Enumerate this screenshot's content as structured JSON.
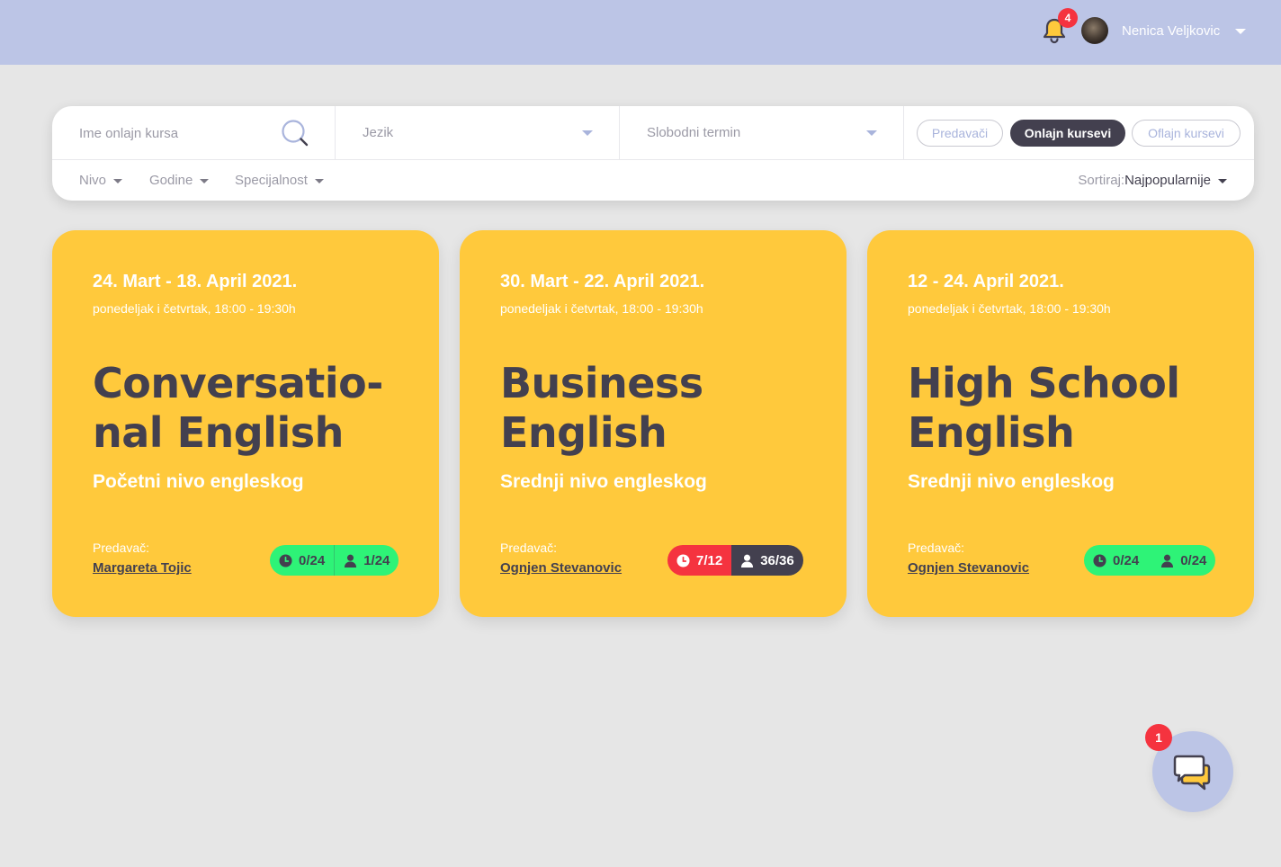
{
  "header": {
    "notifications_count": "4",
    "user_name": "Nenica Veljkovic"
  },
  "filters": {
    "search_placeholder": "Ime onlajn kursa",
    "language_placeholder": "Jezik",
    "slot_placeholder": "Slobodni termin",
    "tabs": [
      {
        "label": "Predavači",
        "active": false
      },
      {
        "label": "Onlajn kursevi",
        "active": true
      },
      {
        "label": "Oflajn kursevi",
        "active": false
      }
    ],
    "dropdowns": [
      "Nivo",
      "Godine",
      "Specijalnost"
    ],
    "sort_label": "Sortiraj:",
    "sort_value": "Najpopularnije"
  },
  "courses": [
    {
      "date": "24. Mart - 18. April 2021.",
      "schedule": "ponedeljak i četvrtak, 18:00 - 19:30h",
      "title_line1": "Conversatio-",
      "title_line2": "nal English",
      "level": "Početni nivo engleskog",
      "lecturer_label": "Predavač:",
      "lecturer": "Margareta Tojic",
      "hours": "0/24",
      "students": "1/24"
    },
    {
      "date": "30. Mart - 22. April 2021.",
      "schedule": "ponedeljak i četvrtak, 18:00 - 19:30h",
      "title_line1": "Business",
      "title_line2": "English",
      "level": "Srednji nivo engleskog",
      "lecturer_label": "Predavač:",
      "lecturer": "Ognjen Stevanovic",
      "hours": "7/12",
      "students": "36/36"
    },
    {
      "date": "12 - 24. April 2021.",
      "schedule": "ponedeljak i četvrtak, 18:00 - 19:30h",
      "title_line1": "High School",
      "title_line2": "English",
      "level": "Srednji nivo engleskog",
      "lecturer_label": "Predavač:",
      "lecturer": "Ognjen Stevanovic",
      "hours": "0/24",
      "students": "0/24"
    }
  ],
  "chat": {
    "unread_count": "1"
  },
  "colors": {
    "topbar": "#bcc5e6",
    "card": "#ffc93c",
    "dark": "#43404f",
    "green": "#2ef377",
    "red": "#f5333f"
  }
}
